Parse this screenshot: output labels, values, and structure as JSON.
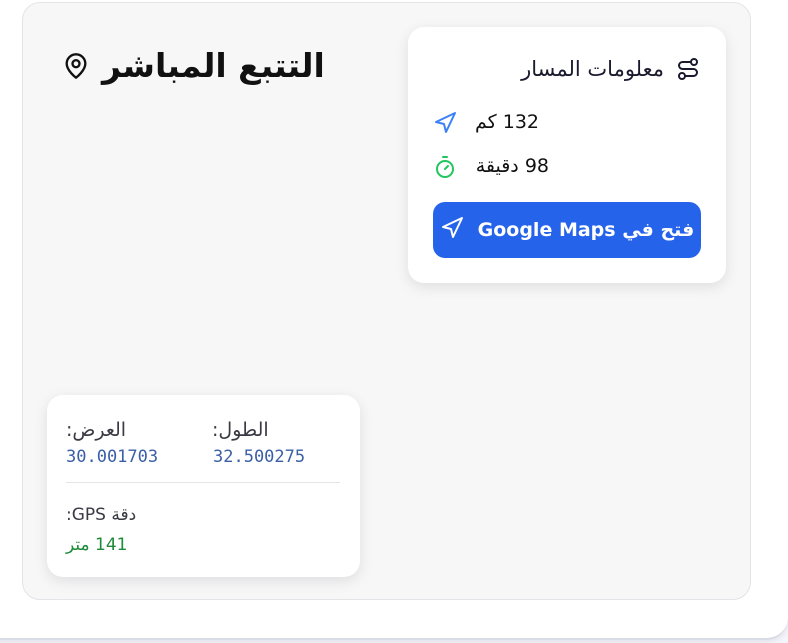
{
  "tracking": {
    "title": "التتبع المباشر"
  },
  "route_info": {
    "title": "معلومات المسار",
    "distance": "132 كم",
    "duration": "98 دقيقة",
    "maps_button_label": "فتح في Google Maps"
  },
  "coordinates": {
    "latitude_label": "العرض:",
    "latitude_value": "30.001703",
    "longitude_label": "الطول:",
    "longitude_value": "32.500275",
    "gps_accuracy_label": "دقة GPS:",
    "gps_accuracy_value": "141 متر"
  },
  "colors": {
    "primary_button": "#2563eb",
    "distance_icon": "#3b82f6",
    "timer_icon": "#22c55e",
    "coordinate_value": "#3b5fa6",
    "gps_accuracy": "#1f8a3a"
  },
  "icons": {
    "title": "map-pin-icon",
    "route": "route-icon",
    "distance": "navigation-arrow-icon",
    "duration": "timer-icon",
    "maps_button": "navigation-arrow-icon"
  }
}
